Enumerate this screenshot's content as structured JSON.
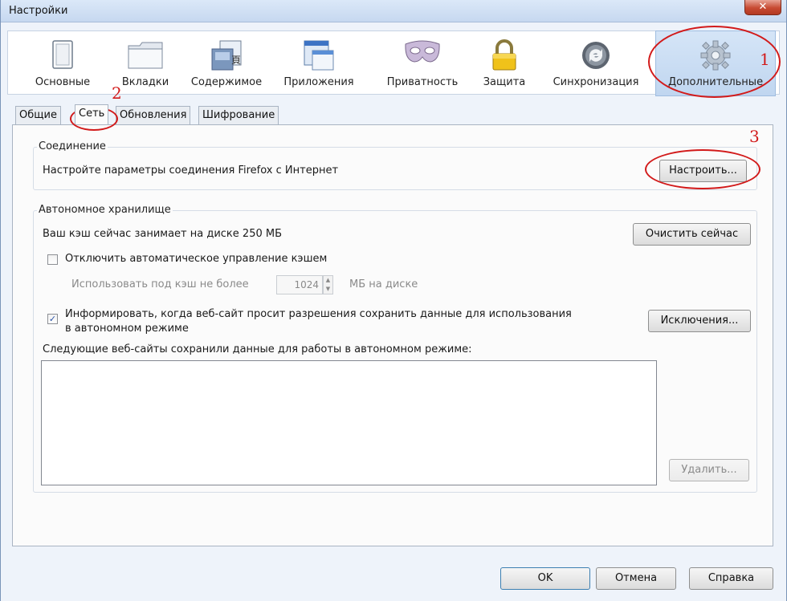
{
  "window": {
    "title": "Настройки",
    "close_glyph": "✕"
  },
  "toolbar": {
    "items": [
      {
        "label": "Основные",
        "icon": "switch-icon"
      },
      {
        "label": "Вкладки",
        "icon": "folder-tabs-icon"
      },
      {
        "label": "Содержимое",
        "icon": "content-icon"
      },
      {
        "label": "Приложения",
        "icon": "applications-icon"
      },
      {
        "label": "Приватность",
        "icon": "mask-icon"
      },
      {
        "label": "Защита",
        "icon": "lock-icon"
      },
      {
        "label": "Синхронизация",
        "icon": "sync-icon"
      },
      {
        "label": "Дополнительные",
        "icon": "gear-icon",
        "selected": true
      }
    ]
  },
  "tabs": [
    {
      "label": "Общие"
    },
    {
      "label": "Сеть",
      "active": true
    },
    {
      "label": "Обновления"
    },
    {
      "label": "Шифрование"
    }
  ],
  "connection": {
    "title": "Соединение",
    "description": "Настройте параметры соединения Firefox с Интернет",
    "configure_button": "Настроить..."
  },
  "offline": {
    "title": "Автономное хранилище",
    "cache_status": "Ваш кэш сейчас занимает на диске 250 МБ",
    "clear_button": "Очистить сейчас",
    "disable_auto_cache_label": "Отключить автоматическое управление кэшем",
    "disable_auto_cache_checked": false,
    "cache_limit_label": "Использовать под кэш не более",
    "cache_limit_value": "1024",
    "cache_limit_unit": "МБ на диске",
    "notify_label_line1": "Информировать, когда веб-сайт просит разрешения сохранить данные для использования",
    "notify_label_line2": "в автономном режиме",
    "notify_checked": true,
    "exceptions_button": "Исключения...",
    "sites_list_label": "Следующие веб-сайты сохранили данные для работы в автономном режиме:",
    "remove_button": "Удалить..."
  },
  "footer": {
    "ok_button": "OK",
    "cancel_button": "Отмена",
    "help_button": "Справка"
  },
  "annotations": {
    "n1": "1",
    "n2": "2",
    "n3": "3"
  },
  "colors": {
    "annotation": "#d21a1a",
    "selected_tab_bg": "#c8dcf2"
  }
}
